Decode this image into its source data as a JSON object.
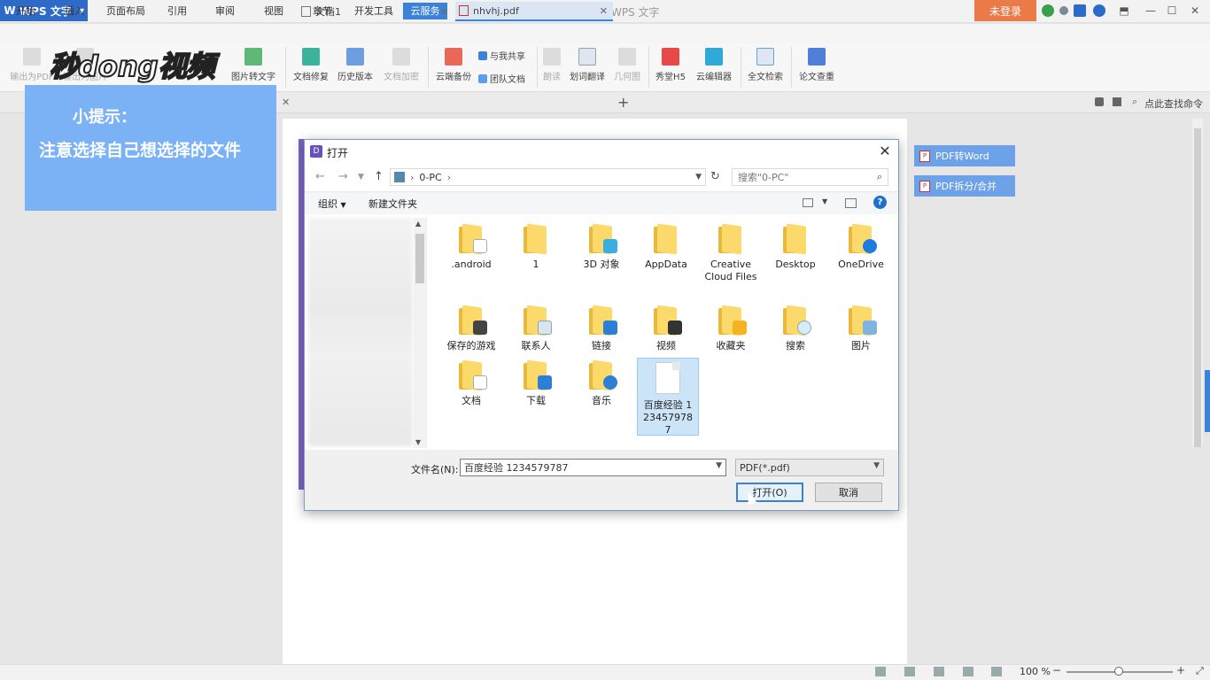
{
  "app": {
    "brand": "WPS 文字",
    "window_title": "nhvhj.pdf - WPS 文字",
    "login": "未登录"
  },
  "menu": [
    "开始",
    "插入",
    "页面布局",
    "引用",
    "审阅",
    "视图",
    "章节",
    "开发工具",
    "云服务"
  ],
  "menu_active_index": 8,
  "ribbon": {
    "left_items": [
      "输出为PDF",
      "输出为图片",
      "",
      "",
      "图片转文字"
    ],
    "doc_repair": "文档修复",
    "history": "历史版本",
    "encrypt": "文档加密",
    "cloud_backup": "云端备份",
    "shared_with_me": "与我共享",
    "team_docs": "团队文档",
    "read_aloud": "朗读",
    "translate": "划词翻译",
    "geometry": "几何图",
    "h5": "秀堂H5",
    "cloud_editor": "云编辑器",
    "fulltext_search": "全文检索",
    "paper_check": "论文查重"
  },
  "tabs": {
    "doc1": "文档1",
    "pdf": "nhvhj.pdf",
    "find_cmd": "点此查找命令"
  },
  "side_buttons": {
    "pdf_to_word": "PDF转Word",
    "pdf_split": "PDF拆分/合并"
  },
  "tip": {
    "title": "小提示：",
    "body": "注意选择自己想选择的文件"
  },
  "watermark": "秒dong视频",
  "dialog": {
    "title": "打开",
    "path": "0-PC",
    "search_placeholder": "搜索\"0-PC\"",
    "organize": "组织",
    "new_folder": "新建文件夹",
    "filename_label": "文件名(N):",
    "filename_value": "百度经验 1234579787",
    "filetype": "PDF(*.pdf)",
    "open_button": "打开(O)",
    "cancel_button": "取消",
    "items": [
      ".android",
      "1",
      "3D 对象",
      "AppData",
      "Creative Cloud Files",
      "Desktop",
      "OneDrive",
      "保存的游戏",
      "联系人",
      "链接",
      "视频",
      "收藏夹",
      "搜索",
      "图片",
      "文档",
      "下载",
      "音乐",
      "百度经验 1234579787"
    ]
  },
  "status": {
    "zoom": "100 %"
  }
}
